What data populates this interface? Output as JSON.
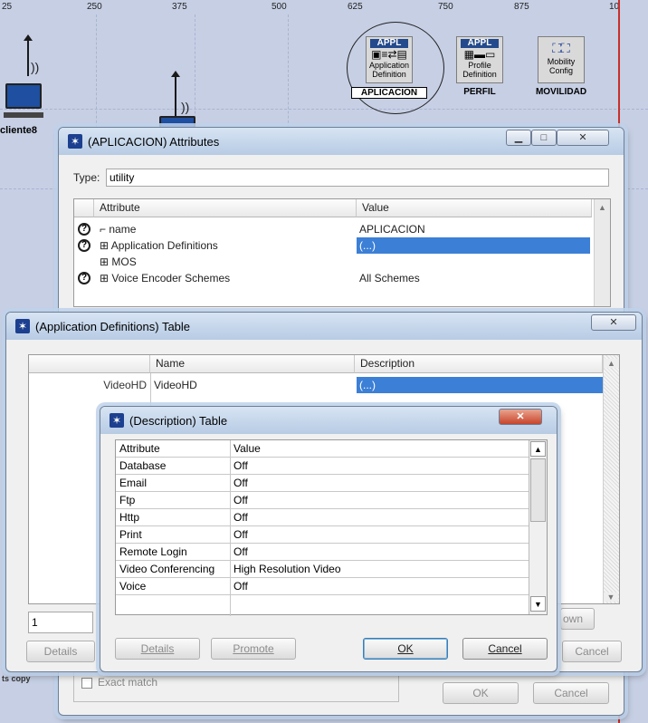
{
  "ruler": [
    "25",
    "250",
    "375",
    "500",
    "625",
    "750",
    "875",
    "10"
  ],
  "nodes": {
    "app_def": {
      "header": "APPL",
      "line1": "Application",
      "line2": "Definition",
      "label": "APLICACION"
    },
    "profile": {
      "header": "APPL",
      "line1": "Profile",
      "line2": "Definition",
      "label": "PERFIL"
    },
    "mobility": {
      "line1": "Mobility",
      "line2": "Config",
      "label": "MOVILIDAD"
    },
    "client_label": "cliente8"
  },
  "attr_window": {
    "title": "(APLICACION) Attributes",
    "type_label": "Type:",
    "type_value": "utility",
    "col_attribute": "Attribute",
    "col_value": "Value",
    "rows": [
      {
        "attr": "name",
        "value": "APLICACION",
        "help": true
      },
      {
        "attr": "Application Definitions",
        "value": "(...)",
        "help": true,
        "expand": true,
        "selected": true
      },
      {
        "attr": "MOS",
        "value": "",
        "help": false,
        "expand": true
      },
      {
        "attr": "Voice Encoder Schemes",
        "value": "All Schemes",
        "help": true,
        "expand": true
      }
    ],
    "exact_match": "Exact match",
    "ok": "OK",
    "cancel": "Cancel",
    "copy_fragment": "ts copy"
  },
  "appdef_window": {
    "title": "(Application Definitions) Table",
    "col_name": "Name",
    "col_description": "Description",
    "row_index": "VideoHD",
    "row_name": "VideoHD",
    "row_description": "(...)",
    "rows_value": "1",
    "details": "Details",
    "down": "own",
    "cancel": "Cancel"
  },
  "desc_window": {
    "title": "(Description) Table",
    "col_attribute": "Attribute",
    "col_value": "Value",
    "rows": [
      {
        "attr": "Database",
        "value": "Off"
      },
      {
        "attr": "Email",
        "value": "Off"
      },
      {
        "attr": "Ftp",
        "value": "Off"
      },
      {
        "attr": "Http",
        "value": "Off"
      },
      {
        "attr": "Print",
        "value": "Off"
      },
      {
        "attr": "Remote Login",
        "value": "Off"
      },
      {
        "attr": "Video Conferencing",
        "value": "High Resolution Video"
      },
      {
        "attr": "Voice",
        "value": "Off"
      }
    ],
    "details": "Details",
    "promote": "Promote",
    "ok": "OK",
    "cancel": "Cancel"
  }
}
